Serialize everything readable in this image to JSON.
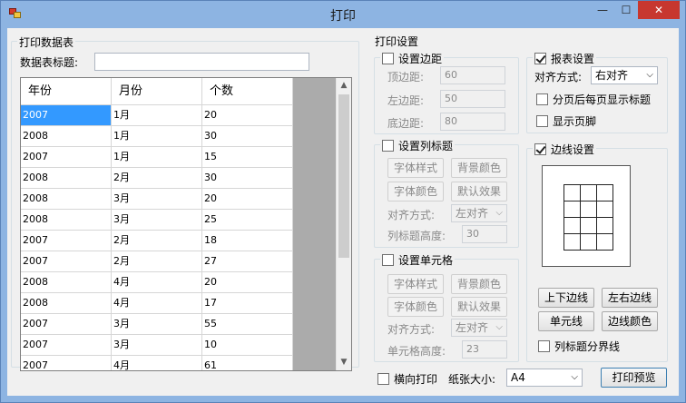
{
  "window": {
    "title": "打印",
    "min": "—",
    "max": "☐",
    "close": "✕"
  },
  "data_table": {
    "group_title": "打印数据表",
    "title_label": "数据表标题:",
    "title_value": "",
    "columns": [
      "年份",
      "月份",
      "个数"
    ],
    "rows": [
      [
        "2007",
        "1月",
        "20"
      ],
      [
        "2008",
        "1月",
        "30"
      ],
      [
        "2007",
        "1月",
        "15"
      ],
      [
        "2008",
        "2月",
        "30"
      ],
      [
        "2008",
        "3月",
        "20"
      ],
      [
        "2008",
        "3月",
        "25"
      ],
      [
        "2007",
        "2月",
        "18"
      ],
      [
        "2007",
        "2月",
        "27"
      ],
      [
        "2008",
        "4月",
        "20"
      ],
      [
        "2008",
        "4月",
        "17"
      ],
      [
        "2007",
        "3月",
        "55"
      ],
      [
        "2007",
        "3月",
        "10"
      ],
      [
        "2007",
        "4月",
        "61"
      ]
    ]
  },
  "print_settings": {
    "group_title": "打印设置",
    "margins": {
      "label": "设置边距",
      "checked": false,
      "top_label": "顶边距:",
      "top": "60",
      "left_label": "左边距:",
      "left": "50",
      "bottom_label": "底边距:",
      "bottom": "80"
    },
    "column_header": {
      "label": "设置列标题",
      "checked": false,
      "font_style": "字体样式",
      "bg_color": "背景颜色",
      "font_color": "字体颜色",
      "default_effect": "默认效果",
      "align_label": "对齐方式:",
      "align_value": "左对齐",
      "height_label": "列标题高度:",
      "height_value": "30"
    },
    "cell": {
      "label": "设置单元格",
      "checked": false,
      "font_style": "字体样式",
      "bg_color": "背景颜色",
      "font_color": "字体颜色",
      "default_effect": "默认效果",
      "align_label": "对齐方式:",
      "align_value": "左对齐",
      "height_label": "单元格高度:",
      "height_value": "23"
    },
    "report": {
      "label": "报表设置",
      "checked": true,
      "align_label": "对齐方式:",
      "align_value": "右对齐",
      "title_each_page": "分页后每页显示标题",
      "show_footer": "显示页脚"
    },
    "border": {
      "label": "边线设置",
      "checked": true,
      "top_bottom": "上下边线",
      "left_right": "左右边线",
      "cell_line": "单元线",
      "line_color": "边线颜色",
      "column_divider": "列标题分界线"
    }
  },
  "footer": {
    "landscape_label": "横向打印",
    "paper_label": "纸张大小:",
    "paper_value": "A4",
    "preview_button": "打印预览"
  }
}
